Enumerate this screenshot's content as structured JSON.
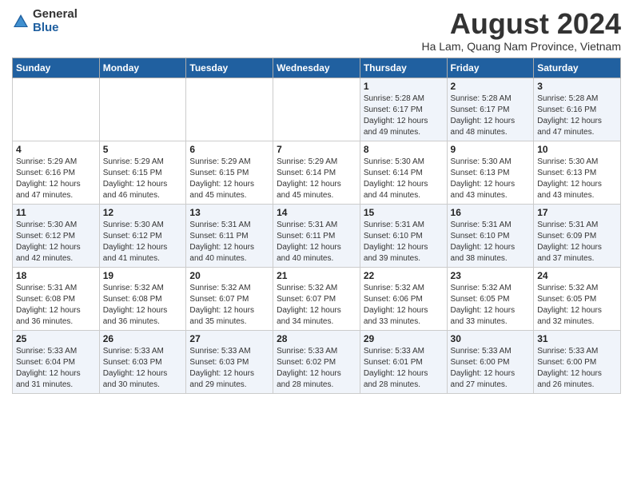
{
  "logo": {
    "general": "General",
    "blue": "Blue"
  },
  "title": "August 2024",
  "subtitle": "Ha Lam, Quang Nam Province, Vietnam",
  "headers": [
    "Sunday",
    "Monday",
    "Tuesday",
    "Wednesday",
    "Thursday",
    "Friday",
    "Saturday"
  ],
  "weeks": [
    [
      {
        "day": "",
        "info": ""
      },
      {
        "day": "",
        "info": ""
      },
      {
        "day": "",
        "info": ""
      },
      {
        "day": "",
        "info": ""
      },
      {
        "day": "1",
        "info": "Sunrise: 5:28 AM\nSunset: 6:17 PM\nDaylight: 12 hours\nand 49 minutes."
      },
      {
        "day": "2",
        "info": "Sunrise: 5:28 AM\nSunset: 6:17 PM\nDaylight: 12 hours\nand 48 minutes."
      },
      {
        "day": "3",
        "info": "Sunrise: 5:28 AM\nSunset: 6:16 PM\nDaylight: 12 hours\nand 47 minutes."
      }
    ],
    [
      {
        "day": "4",
        "info": "Sunrise: 5:29 AM\nSunset: 6:16 PM\nDaylight: 12 hours\nand 47 minutes."
      },
      {
        "day": "5",
        "info": "Sunrise: 5:29 AM\nSunset: 6:15 PM\nDaylight: 12 hours\nand 46 minutes."
      },
      {
        "day": "6",
        "info": "Sunrise: 5:29 AM\nSunset: 6:15 PM\nDaylight: 12 hours\nand 45 minutes."
      },
      {
        "day": "7",
        "info": "Sunrise: 5:29 AM\nSunset: 6:14 PM\nDaylight: 12 hours\nand 45 minutes."
      },
      {
        "day": "8",
        "info": "Sunrise: 5:30 AM\nSunset: 6:14 PM\nDaylight: 12 hours\nand 44 minutes."
      },
      {
        "day": "9",
        "info": "Sunrise: 5:30 AM\nSunset: 6:13 PM\nDaylight: 12 hours\nand 43 minutes."
      },
      {
        "day": "10",
        "info": "Sunrise: 5:30 AM\nSunset: 6:13 PM\nDaylight: 12 hours\nand 43 minutes."
      }
    ],
    [
      {
        "day": "11",
        "info": "Sunrise: 5:30 AM\nSunset: 6:12 PM\nDaylight: 12 hours\nand 42 minutes."
      },
      {
        "day": "12",
        "info": "Sunrise: 5:30 AM\nSunset: 6:12 PM\nDaylight: 12 hours\nand 41 minutes."
      },
      {
        "day": "13",
        "info": "Sunrise: 5:31 AM\nSunset: 6:11 PM\nDaylight: 12 hours\nand 40 minutes."
      },
      {
        "day": "14",
        "info": "Sunrise: 5:31 AM\nSunset: 6:11 PM\nDaylight: 12 hours\nand 40 minutes."
      },
      {
        "day": "15",
        "info": "Sunrise: 5:31 AM\nSunset: 6:10 PM\nDaylight: 12 hours\nand 39 minutes."
      },
      {
        "day": "16",
        "info": "Sunrise: 5:31 AM\nSunset: 6:10 PM\nDaylight: 12 hours\nand 38 minutes."
      },
      {
        "day": "17",
        "info": "Sunrise: 5:31 AM\nSunset: 6:09 PM\nDaylight: 12 hours\nand 37 minutes."
      }
    ],
    [
      {
        "day": "18",
        "info": "Sunrise: 5:31 AM\nSunset: 6:08 PM\nDaylight: 12 hours\nand 36 minutes."
      },
      {
        "day": "19",
        "info": "Sunrise: 5:32 AM\nSunset: 6:08 PM\nDaylight: 12 hours\nand 36 minutes."
      },
      {
        "day": "20",
        "info": "Sunrise: 5:32 AM\nSunset: 6:07 PM\nDaylight: 12 hours\nand 35 minutes."
      },
      {
        "day": "21",
        "info": "Sunrise: 5:32 AM\nSunset: 6:07 PM\nDaylight: 12 hours\nand 34 minutes."
      },
      {
        "day": "22",
        "info": "Sunrise: 5:32 AM\nSunset: 6:06 PM\nDaylight: 12 hours\nand 33 minutes."
      },
      {
        "day": "23",
        "info": "Sunrise: 5:32 AM\nSunset: 6:05 PM\nDaylight: 12 hours\nand 33 minutes."
      },
      {
        "day": "24",
        "info": "Sunrise: 5:32 AM\nSunset: 6:05 PM\nDaylight: 12 hours\nand 32 minutes."
      }
    ],
    [
      {
        "day": "25",
        "info": "Sunrise: 5:33 AM\nSunset: 6:04 PM\nDaylight: 12 hours\nand 31 minutes."
      },
      {
        "day": "26",
        "info": "Sunrise: 5:33 AM\nSunset: 6:03 PM\nDaylight: 12 hours\nand 30 minutes."
      },
      {
        "day": "27",
        "info": "Sunrise: 5:33 AM\nSunset: 6:03 PM\nDaylight: 12 hours\nand 29 minutes."
      },
      {
        "day": "28",
        "info": "Sunrise: 5:33 AM\nSunset: 6:02 PM\nDaylight: 12 hours\nand 28 minutes."
      },
      {
        "day": "29",
        "info": "Sunrise: 5:33 AM\nSunset: 6:01 PM\nDaylight: 12 hours\nand 28 minutes."
      },
      {
        "day": "30",
        "info": "Sunrise: 5:33 AM\nSunset: 6:00 PM\nDaylight: 12 hours\nand 27 minutes."
      },
      {
        "day": "31",
        "info": "Sunrise: 5:33 AM\nSunset: 6:00 PM\nDaylight: 12 hours\nand 26 minutes."
      }
    ]
  ]
}
